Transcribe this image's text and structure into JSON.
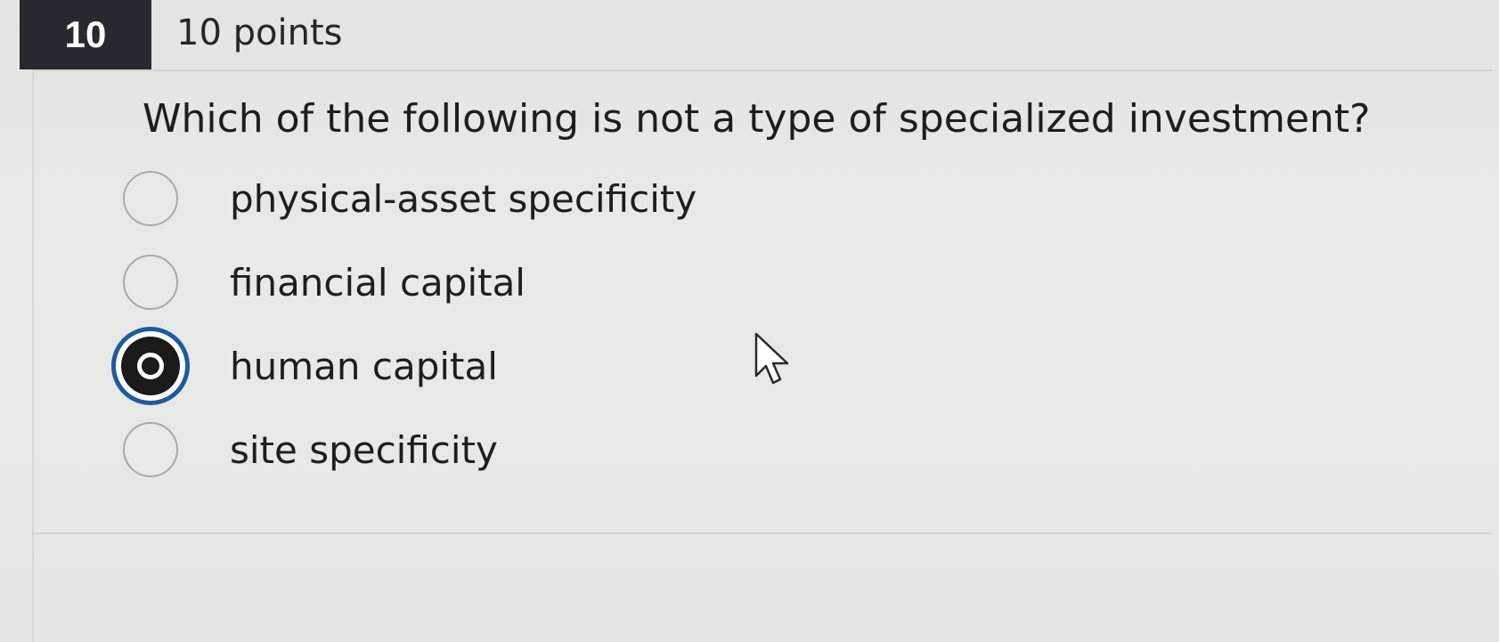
{
  "question": {
    "number": "10",
    "points": "10 points",
    "text": "Which of the following is not a type of specialized investment?"
  },
  "options": [
    {
      "label": "physical-asset specificity",
      "selected": false
    },
    {
      "label": "financial capital",
      "selected": false
    },
    {
      "label": "human capital",
      "selected": true
    },
    {
      "label": "site specificity",
      "selected": false
    }
  ],
  "colors": {
    "selected_ring": "#1d5c9a",
    "header_box": "#262a30"
  },
  "icons": {
    "cursor": "mouse-pointer-icon"
  }
}
